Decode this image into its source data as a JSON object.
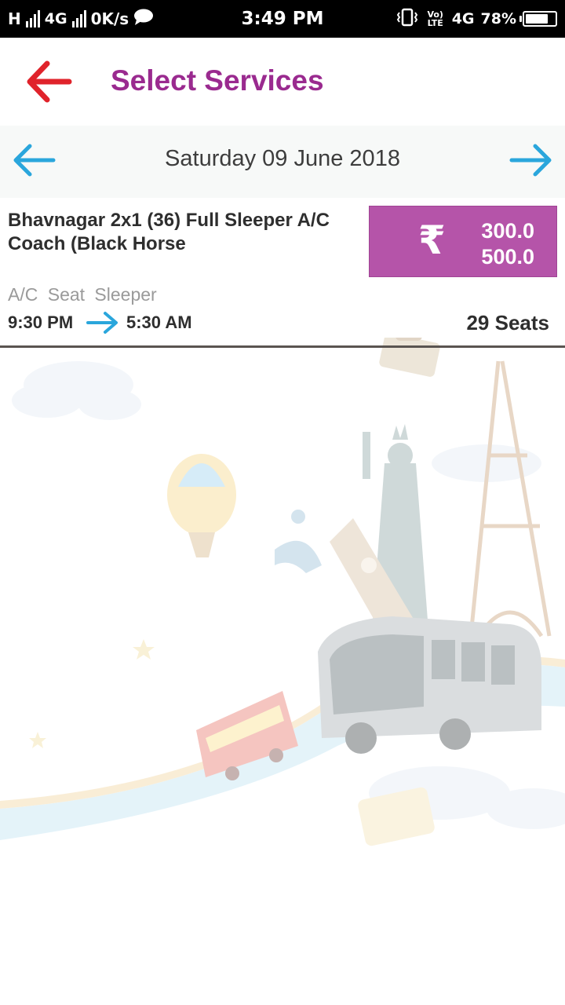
{
  "status_bar": {
    "network_left": "H",
    "roaming_mark": "R",
    "network_type": "4G",
    "speed": "0K/s",
    "time": "3:49 PM",
    "volte_label": "Vo) LTE",
    "network_right": "4G",
    "sim_slot": "2",
    "battery_percent": "78%",
    "battery_level": 0.78
  },
  "header": {
    "title": "Select Services",
    "back_icon": "back-arrow-icon",
    "back_icon_color": "#e0232b",
    "title_color": "#9a2a8f"
  },
  "date_bar": {
    "date": "Saturday 09 June 2018",
    "prev_icon": "arrow-left-icon",
    "next_icon": "arrow-right-icon",
    "arrow_color": "#2aa6dc"
  },
  "services": [
    {
      "bus_name": "Bhavnagar 2x1 (36) Full Sleeper A/C Coach (Black Horse",
      "currency_symbol": "₹",
      "fare_1": "300.0",
      "fare_2": "500.0",
      "bus_type": "A/C Seat Sleeper",
      "departure": "9:30 PM",
      "arrival": "5:30 AM",
      "seats": "29 Seats",
      "fare_box_color": "#b554a9"
    }
  ]
}
